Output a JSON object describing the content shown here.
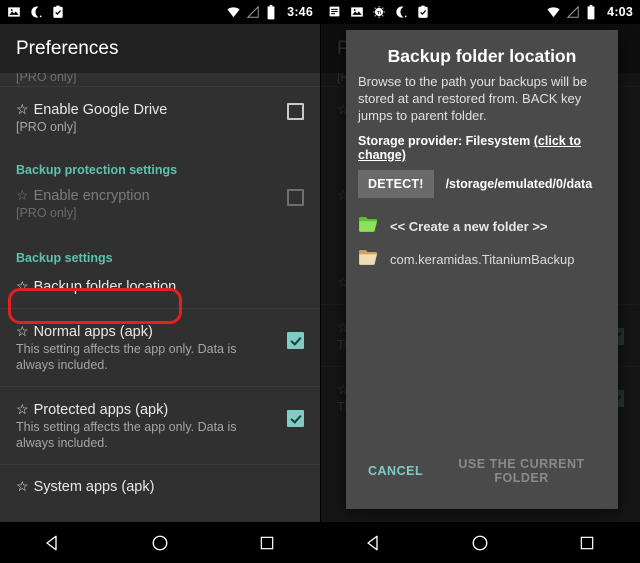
{
  "left_screen": {
    "status_bar": {
      "icons": [
        "image-icon",
        "moon-icon",
        "clipboard-check-icon"
      ],
      "right_icons": [
        "wifi-icon",
        "signal-off-icon",
        "battery-icon"
      ],
      "time": "3:46"
    },
    "app_bar": {
      "title": "Preferences"
    },
    "clipped_row_text": "[PRO only]",
    "rows": [
      {
        "type": "pref",
        "title": "Enable Google Drive",
        "subtitle": "[PRO only]",
        "checkbox": "unchecked",
        "dim": false
      },
      {
        "type": "section",
        "title": "Backup protection settings"
      },
      {
        "type": "pref",
        "title": "Enable encryption",
        "subtitle": "[PRO only]",
        "checkbox": "unchecked",
        "dim": true
      },
      {
        "type": "section",
        "title": "Backup settings"
      },
      {
        "type": "pref",
        "title": "Backup folder location",
        "subtitle": "",
        "checkbox": "none",
        "dim": false,
        "highlighted": true
      },
      {
        "type": "pref",
        "title": "Normal apps (apk)",
        "subtitle": "This setting affects the app only. Data is always included.",
        "checkbox": "checked",
        "dim": false
      },
      {
        "type": "pref",
        "title": "Protected apps (apk)",
        "subtitle": "This setting affects the app only. Data is always included.",
        "checkbox": "checked",
        "dim": false
      },
      {
        "type": "pref",
        "title": "System apps (apk)",
        "subtitle": "",
        "checkbox": "none",
        "dim": false
      }
    ],
    "star_glyph": "☆",
    "nav_bar": [
      "back-icon",
      "home-icon",
      "recents-icon"
    ]
  },
  "right_screen": {
    "status_bar": {
      "icons": [
        "notes-icon",
        "image-icon",
        "titanium-backup-icon",
        "moon-icon",
        "clipboard-check-icon"
      ],
      "right_icons": [
        "wifi-icon",
        "signal-off-icon",
        "battery-icon"
      ],
      "time": "4:03"
    },
    "background": {
      "app_bar_title": "Preferences",
      "visible_text": "This setting affects the app only. Data is"
    },
    "dialog": {
      "title": "Backup folder location",
      "description": "Browse to the path your backups will be stored at and restored from. BACK key jumps to parent folder.",
      "provider_label": "Storage provider: Filesystem",
      "provider_link": "(click to change)",
      "detect_button": "DETECT!",
      "current_path": "/storage/emulated/0/data",
      "folders": [
        {
          "name": "<< Create a new folder >>",
          "icon": "folder-new-icon",
          "color": "#6fce3e"
        },
        {
          "name": "com.keramidas.TitaniumBackup",
          "icon": "folder-icon",
          "color": "#e0c082"
        }
      ],
      "cancel_label": "CANCEL",
      "confirm_label": "USE THE CURRENT FOLDER"
    },
    "nav_bar": [
      "back-icon",
      "home-icon",
      "recents-icon"
    ]
  },
  "colors": {
    "accent_teal": "#5ec2b0",
    "checkbox_checked": "#80cbc4",
    "highlight_red": "#e32020",
    "app_bar": "#212121",
    "list_bg": "#303030",
    "dialog_bg": "#4a4a4a"
  }
}
